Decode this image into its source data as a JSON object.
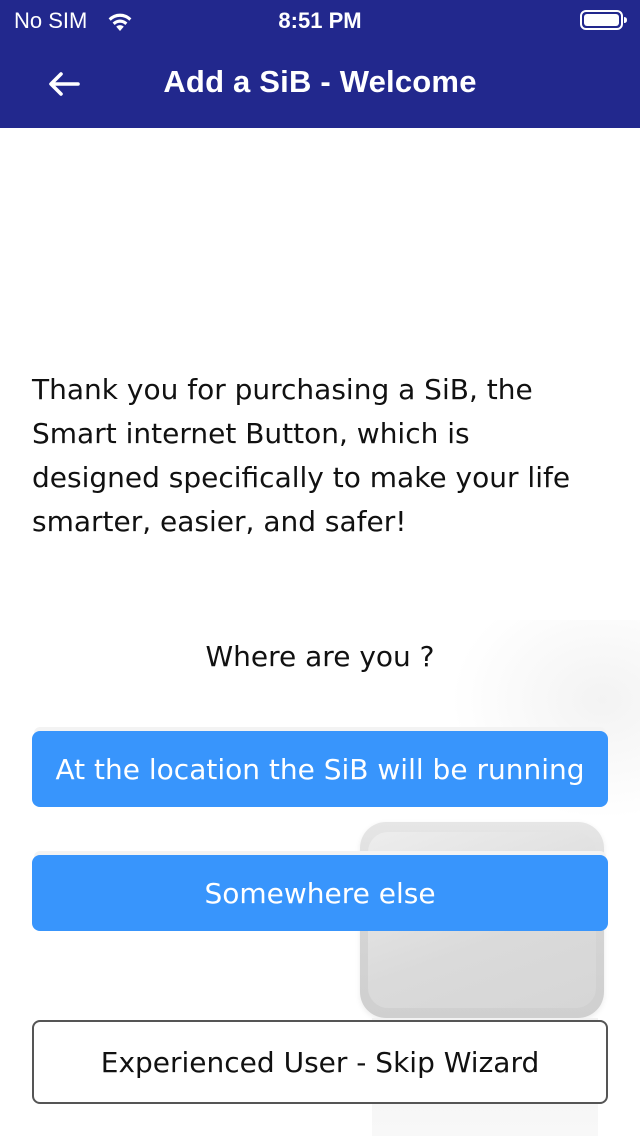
{
  "status_bar": {
    "carrier": "No SIM",
    "time": "8:51 PM",
    "wifi_icon": "wifi-icon",
    "battery_icon": "battery-icon"
  },
  "nav": {
    "back_icon": "arrow-left-icon",
    "title": "Add a SiB - Welcome"
  },
  "content": {
    "intro": "Thank you for purchasing a SiB, the Smart internet Button, which is designed specifically to make your life smarter, easier, and safer!",
    "question": "Where are you ?",
    "buttons": {
      "location": "At the location the SiB will be running",
      "elsewhere": "Somewhere else",
      "skip": "Experienced User - Skip Wizard"
    }
  },
  "colors": {
    "nav_background": "#22288d",
    "primary_button": "#3895fc",
    "text": "#111111"
  }
}
